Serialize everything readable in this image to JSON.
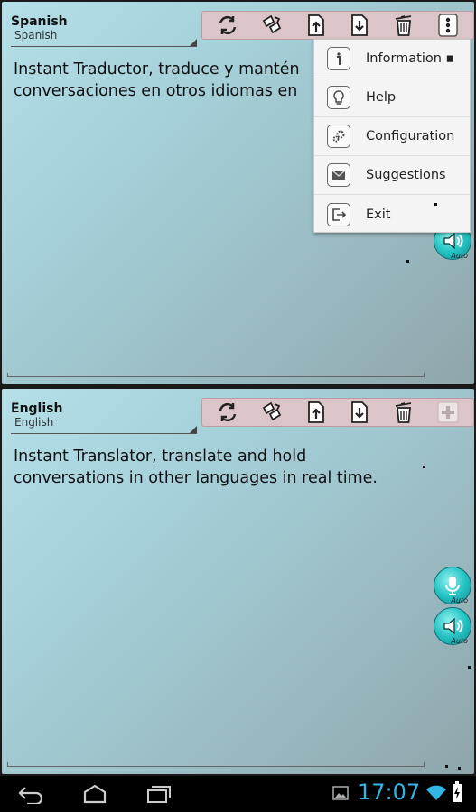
{
  "top_panel": {
    "language": "Spanish",
    "language_sub": "Spanish",
    "text": "Instant Traductor, traduce y mantén\nconversaciones en otros idiomas en",
    "toolbar": [
      "refresh-icon",
      "swap-icon",
      "upload-icon",
      "download-icon",
      "trash-icon",
      "overflow-menu-icon"
    ]
  },
  "menu": {
    "items": [
      {
        "label": "Information ▪",
        "icon": "info-icon"
      },
      {
        "label": "Help",
        "icon": "lightbulb-icon"
      },
      {
        "label": "Configuration",
        "icon": "gears-icon"
      },
      {
        "label": "Suggestions",
        "icon": "envelope-icon"
      },
      {
        "label": "Exit",
        "icon": "exit-icon"
      }
    ]
  },
  "bottom_panel": {
    "language": "English",
    "language_sub": "English",
    "text": "Instant Translator, translate and hold\nconversations in other languages in real time.",
    "toolbar": [
      "refresh-icon",
      "swap-icon",
      "upload-icon",
      "download-icon",
      "trash-icon",
      "add-icon"
    ],
    "mic_label": "Auto",
    "speaker_label": "Auto"
  },
  "top_speaker_label": "Auto",
  "status_bar": {
    "time": "17:07"
  },
  "colors": {
    "toolbar_bg": "#dcc5c9",
    "accent_teal": "#26c4c4",
    "clock": "#33b5e5"
  }
}
